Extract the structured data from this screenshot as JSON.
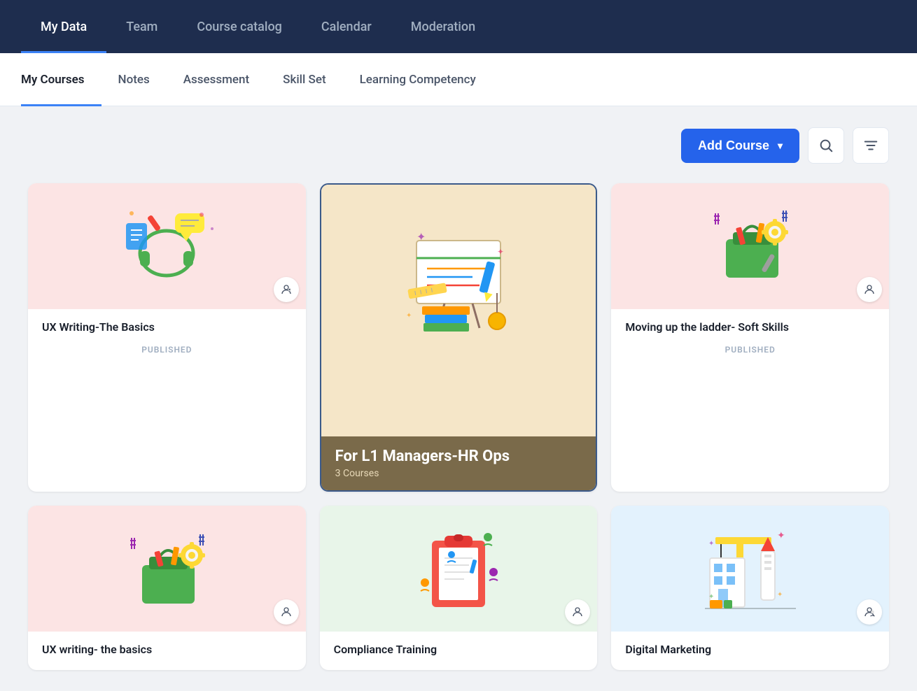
{
  "topNav": {
    "items": [
      {
        "label": "My Data",
        "active": true
      },
      {
        "label": "Team",
        "active": false
      },
      {
        "label": "Course catalog",
        "active": false
      },
      {
        "label": "Calendar",
        "active": false
      },
      {
        "label": "Moderation",
        "active": false
      }
    ]
  },
  "subNav": {
    "items": [
      {
        "label": "My Courses",
        "active": true
      },
      {
        "label": "Notes",
        "active": false
      },
      {
        "label": "Assessment",
        "active": false
      },
      {
        "label": "Skill Set",
        "active": false
      },
      {
        "label": "Learning Competency",
        "active": false
      }
    ]
  },
  "toolbar": {
    "addCourseLabel": "Add Course",
    "chevron": "▾",
    "searchIcon": "🔍",
    "filterIcon": "≡"
  },
  "courses": [
    {
      "id": 1,
      "title": "UX Writing-The Basics",
      "status": "PUBLISHED",
      "theme": "pink",
      "featured": false,
      "illustrationType": "headset"
    },
    {
      "id": 2,
      "title": "For L1 Managers-HR Ops",
      "subTitle": "3 Courses",
      "status": "",
      "theme": "peach",
      "featured": true,
      "illustrationType": "design"
    },
    {
      "id": 3,
      "title": "Moving up the ladder- Soft Skills",
      "status": "PUBLISHED",
      "theme": "light-pink",
      "featured": false,
      "illustrationType": "tools"
    },
    {
      "id": 4,
      "title": "UX writing- the basics",
      "status": "",
      "theme": "light-pink",
      "featured": false,
      "illustrationType": "tools2"
    },
    {
      "id": 5,
      "title": "Compliance Training",
      "status": "",
      "theme": "light-green",
      "featured": false,
      "illustrationType": "clipboard"
    },
    {
      "id": 6,
      "title": "Digital Marketing",
      "status": "",
      "theme": "light-blue",
      "featured": false,
      "illustrationType": "crane"
    }
  ]
}
